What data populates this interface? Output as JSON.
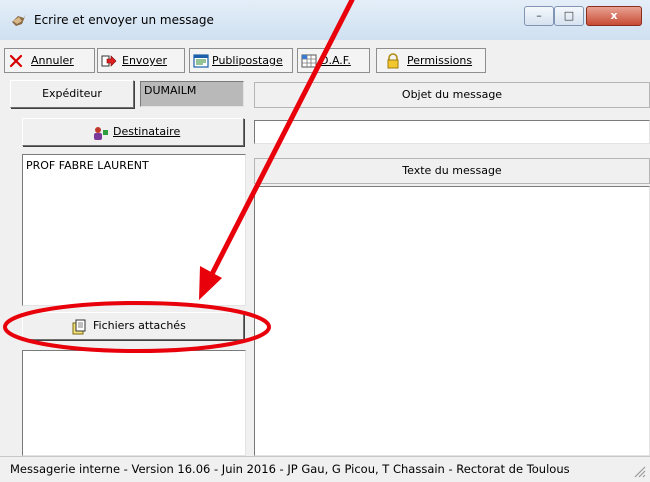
{
  "window": {
    "title": "Ecrire et envoyer un message",
    "controls": {
      "minimize": "–",
      "maximize": "□",
      "close": "x"
    }
  },
  "toolbar": {
    "annuler": "Annuler",
    "envoyer": "Envoyer",
    "publipostage": "Publipostage",
    "daf": "D.A.F.",
    "permissions": "Permissions"
  },
  "left": {
    "expediteur_label": "Expéditeur",
    "expediteur_value": "DUMAILM",
    "destinataire_button": "Destinataire",
    "recipients": [
      "PROF FABRE LAURENT"
    ],
    "fichiers_button": "Fichiers attachés"
  },
  "right": {
    "objet_header": "Objet du message",
    "objet_value": "",
    "texte_header": "Texte du message",
    "texte_value": ""
  },
  "status": {
    "text": "Messagerie interne - Version 16.06 - Juin 2016 - JP Gau, G Picou, T Chassain - Rectorat de Toulous"
  },
  "annotation": {
    "arrow_color": "#e8000b",
    "ellipse_color": "#e8000b"
  }
}
